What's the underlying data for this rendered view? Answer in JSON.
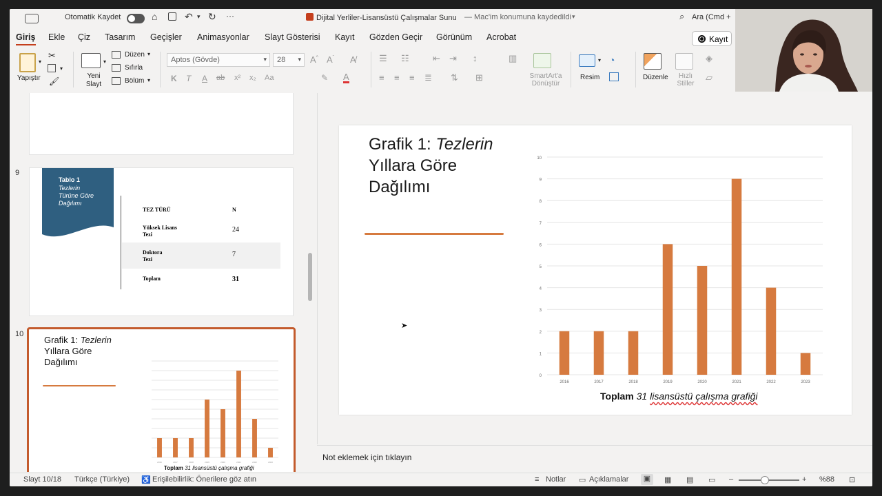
{
  "titlebar": {
    "autosave": "Otomatik Kaydet",
    "doc_title": "Dijital Yerliler-Lisansüstü Çalışmalar Sunu",
    "save_status": "— Mac'im konumuna kaydedildi",
    "search": "Ara (Cmd +"
  },
  "menu": {
    "tabs": [
      "Giriş",
      "Ekle",
      "Çiz",
      "Tasarım",
      "Geçişler",
      "Animasyonlar",
      "Slayt Gösterisi",
      "Kayıt",
      "Gözden Geçir",
      "Görünüm",
      "Acrobat"
    ],
    "record_button": "Kayıt"
  },
  "ribbon": {
    "paste": "Yapıştır",
    "new_slide": "Yeni Slayt",
    "layout": "Düzen",
    "reset": "Sıfırla",
    "section": "Bölüm",
    "font_name": "Aptos (Gövde)",
    "font_size": "28",
    "bold": "K",
    "italic": "T",
    "underline": "A",
    "smartart": "SmartArt'a Dönüştür",
    "picture": "Resim",
    "arrange": "Düzenle",
    "quick_styles": "Hızlı Stiller"
  },
  "thumbnails": {
    "slide9": {
      "number": "9",
      "banner_title": "Tablo 1",
      "banner_subtitle": "Tezlerin Türüne Göre Dağılımı",
      "col_headers": [
        "TEZ TÜRÜ",
        "N"
      ],
      "rows": [
        {
          "type": "Yüksek Lisans Tezi",
          "n": "24"
        },
        {
          "type": "Doktora Tezi",
          "n": "7"
        },
        {
          "type": "Toplam",
          "n": "31"
        }
      ]
    },
    "slide10": {
      "number": "10",
      "title_plain": "Grafik 1: ",
      "title_italic": "Tezlerin",
      "title_rest": "Yıllara Göre Dağılımı",
      "caption_bold": "Toplam",
      "caption_italic": "31 lisansüstü çalışma grafiği"
    }
  },
  "slide": {
    "title_plain": "Grafik 1: ",
    "title_italic": "Tezlerin",
    "title_line2": "Yıllara Göre",
    "title_line3": "Dağılımı",
    "caption_bold": "Toplam",
    "caption_number": "31",
    "caption_text": "lisansüstü çalışma grafiği",
    "accent_color": "#d67a3f"
  },
  "chart_data": {
    "type": "bar",
    "categories": [
      "2016",
      "2017",
      "2018",
      "2019",
      "2020",
      "2021",
      "2022",
      "2023"
    ],
    "values": [
      2,
      2,
      2,
      6,
      5,
      9,
      4,
      1
    ],
    "ylim": [
      0,
      10
    ],
    "yticks": [
      "0",
      "1",
      "2",
      "3",
      "4",
      "5",
      "6",
      "7",
      "8",
      "9",
      "10"
    ],
    "grid": true,
    "bar_color": "#d67a3f"
  },
  "notes": {
    "placeholder": "Not eklemek için tıklayın"
  },
  "status": {
    "slide_counter": "Slayt 10/18",
    "language": "Türkçe (Türkiye)",
    "accessibility": "Erişilebilirlik: Önerilere göz atın",
    "notes_btn": "Notlar",
    "comments_btn": "Açıklamalar",
    "zoom": "%88"
  }
}
